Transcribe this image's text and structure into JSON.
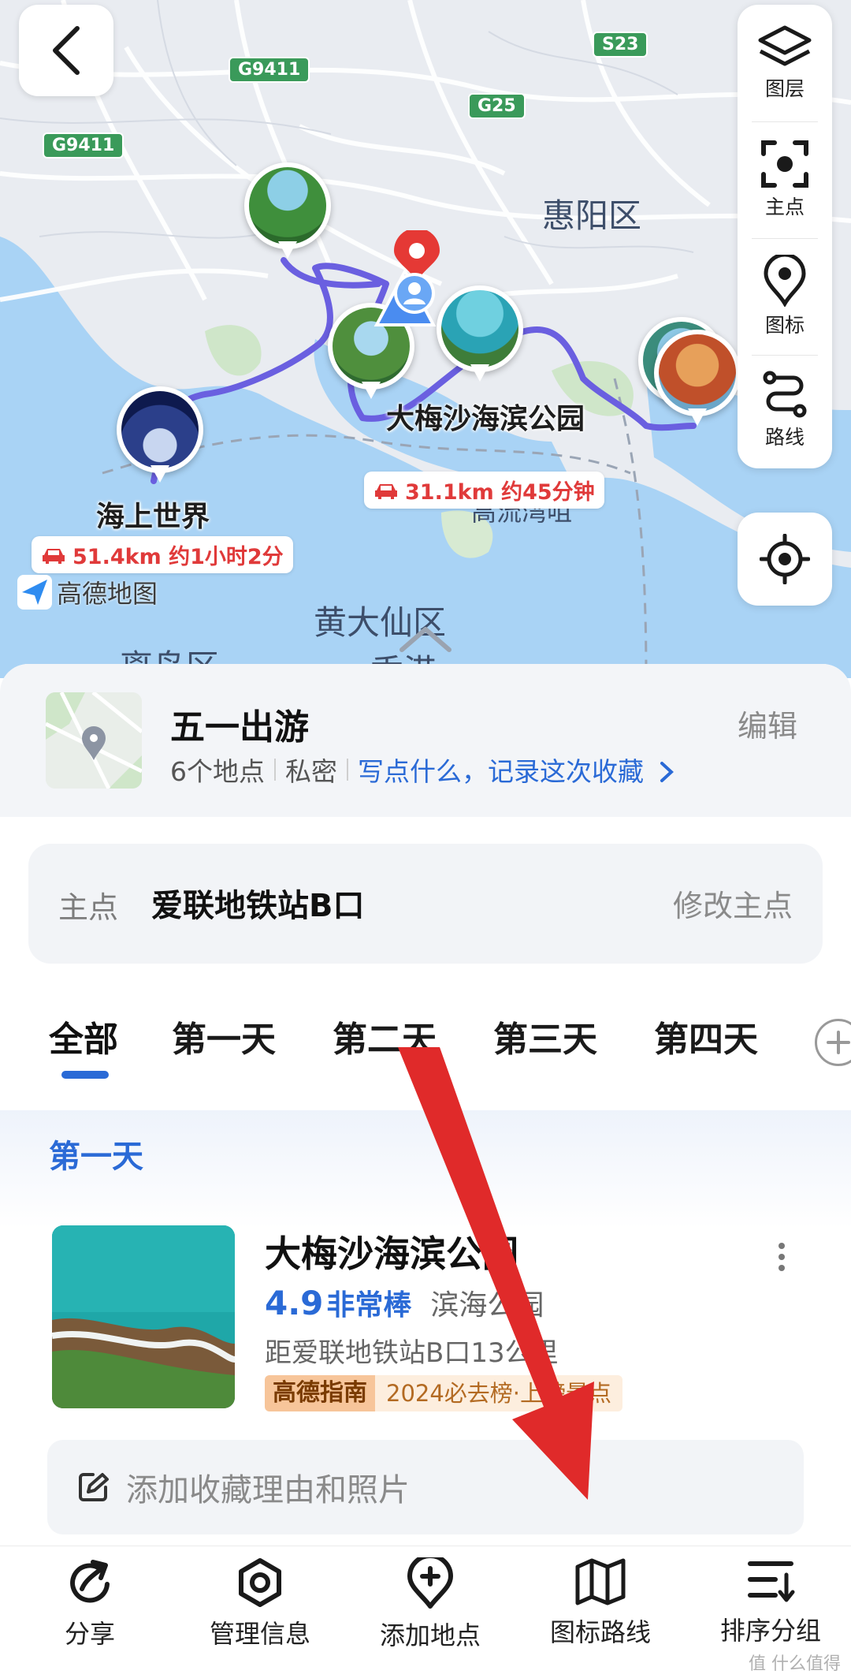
{
  "map": {
    "districts": [
      "惠阳区",
      "黄大仙区",
      "离岛区",
      "香港"
    ],
    "highways": [
      "G9411",
      "G9411",
      "S23",
      "G25"
    ],
    "poi_labels": [
      "大梅沙海滨公园",
      "海上世界",
      "高流湾咀"
    ],
    "drive_estimates": [
      "31.1km 约45分钟",
      "51.4km 约1小时2分"
    ],
    "logo": "高德地图",
    "toolbar": [
      {
        "label": "图层",
        "icon": "layers-icon"
      },
      {
        "label": "主点",
        "icon": "focus-icon"
      },
      {
        "label": "图标",
        "icon": "map-pin-icon"
      },
      {
        "label": "路线",
        "icon": "route-icon"
      }
    ],
    "locate_icon": "locate-icon",
    "back_icon": "back-arrow-icon",
    "route_color": "#6a5fe0",
    "marker_color": "#e53935"
  },
  "favorite": {
    "title": "五一出游",
    "place_count": "6个地点",
    "privacy": "私密",
    "note_prompt": "写点什么，记录这次收藏",
    "edit": "编辑"
  },
  "main_point": {
    "key": "主点",
    "value": "爱联地铁站B口",
    "modify": "修改主点"
  },
  "tabs": [
    "全部",
    "第一天",
    "第二天",
    "第三天",
    "第四天"
  ],
  "active_tab": "全部",
  "day_section": {
    "title": "第一天",
    "poi": {
      "name": "大梅沙海滨公园",
      "score": "4.9",
      "score_word": "非常棒",
      "category": "滨海公园",
      "distance": "距爱联地铁站B口13公里",
      "tag_brand": "高德指南",
      "tag_rank": "2024必去榜·上榜景点"
    },
    "reason_placeholder": "添加收藏理由和照片"
  },
  "action_bar": [
    {
      "label": "分享",
      "icon": "share-icon"
    },
    {
      "label": "管理信息",
      "icon": "settings-icon"
    },
    {
      "label": "添加地点",
      "icon": "add-location-icon"
    },
    {
      "label": "图标路线",
      "icon": "map-route-icon"
    },
    {
      "label": "排序分组",
      "icon": "sort-icon"
    }
  ],
  "watermark": "值 什么值得买",
  "colors": {
    "accent": "#2a6ad6",
    "drive_red": "#e03a3a",
    "annotation_arrow": "#e02a2a"
  }
}
